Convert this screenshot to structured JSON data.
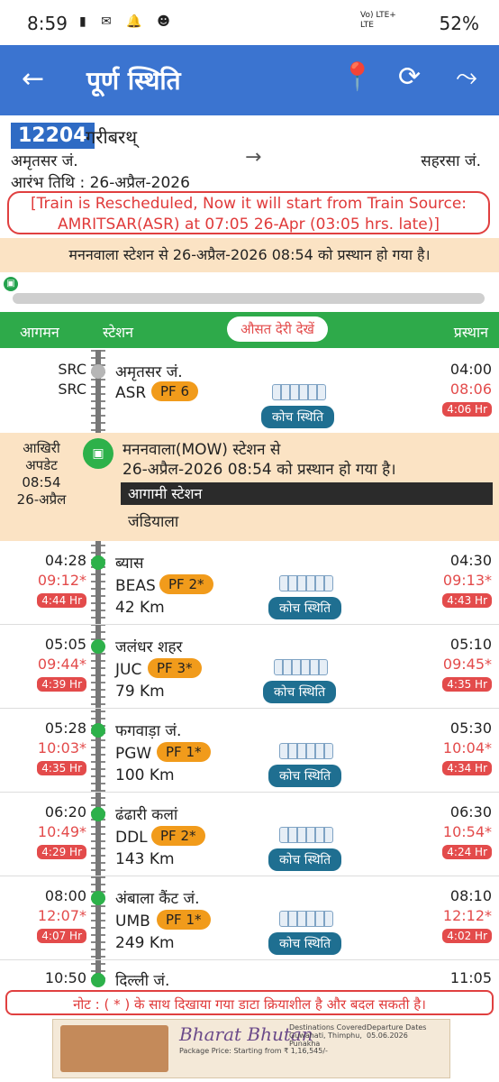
{
  "status": {
    "time": "8:59",
    "network": "Vo) LTE+\nLTE",
    "battery": "52%"
  },
  "appbar": {
    "title": "पूर्ण स्थिति",
    "back_icon": "←",
    "location_icon": "📍",
    "refresh_icon": "⟳",
    "route_icon": "⤳"
  },
  "train": {
    "number": "12204",
    "name": "गरीबरथ्",
    "source": "अमृतसर जं.",
    "destination": "सहरसा जं.",
    "start_date": "आरंभ तिथि : 26-अप्रैल-2026",
    "arrow": "→"
  },
  "reschedule": "[Train is Rescheduled, Now it will start from Train Source: AMRITSAR(ASR) at 07:05 26-Apr (03:05 hrs. late)]",
  "info": "मननवाला स्टेशन से 26-अप्रैल-2026 08:54 को प्रस्थान हो गया है।",
  "header": {
    "arrival": "आगमन",
    "station": "स्टेशन",
    "avg_delay": "औसत देरी देखें",
    "departure": "प्रस्थान"
  },
  "coach_label": "कोच स्थिति",
  "stations": [
    {
      "arr_time": "SRC",
      "arr_actual": "SRC",
      "arr_late": "",
      "name": "अमृतसर जं.",
      "code": "ASR",
      "pf": "PF 6",
      "km": "",
      "dep_time": "04:00",
      "dep_actual": "08:06",
      "dep_late": "4:06 Hr"
    },
    {
      "arr_time": "04:28",
      "arr_actual": "09:12*",
      "arr_late": "4:44 Hr",
      "name": "ब्यास",
      "code": "BEAS",
      "pf": "PF 2*",
      "km": "42 Km",
      "dep_time": "04:30",
      "dep_actual": "09:13*",
      "dep_late": "4:43 Hr"
    },
    {
      "arr_time": "05:05",
      "arr_actual": "09:44*",
      "arr_late": "4:39 Hr",
      "name": "जलंधर शहर",
      "code": "JUC",
      "pf": "PF 3*",
      "km": "79 Km",
      "dep_time": "05:10",
      "dep_actual": "09:45*",
      "dep_late": "4:35 Hr"
    },
    {
      "arr_time": "05:28",
      "arr_actual": "10:03*",
      "arr_late": "4:35 Hr",
      "name": "फगवाड़ा जं.",
      "code": "PGW",
      "pf": "PF 1*",
      "km": "100 Km",
      "dep_time": "05:30",
      "dep_actual": "10:04*",
      "dep_late": "4:34 Hr"
    },
    {
      "arr_time": "06:20",
      "arr_actual": "10:49*",
      "arr_late": "4:29 Hr",
      "name": "ढंढारी कलां",
      "code": "DDL",
      "pf": "PF 2*",
      "km": "143 Km",
      "dep_time": "06:30",
      "dep_actual": "10:54*",
      "dep_late": "4:24 Hr"
    },
    {
      "arr_time": "08:00",
      "arr_actual": "12:07*",
      "arr_late": "4:07 Hr",
      "name": "अंबाला कैंट जं.",
      "code": "UMB",
      "pf": "PF 1*",
      "km": "249 Km",
      "dep_time": "08:10",
      "dep_actual": "12:12*",
      "dep_late": "4:02 Hr"
    },
    {
      "arr_time": "10:50",
      "arr_actual": "",
      "arr_late": "",
      "name": "दिल्ली जं.",
      "code": "",
      "pf": "",
      "km": "",
      "dep_time": "11:05",
      "dep_actual": "",
      "dep_late": ""
    }
  ],
  "last_update": {
    "label": "आखिरी\nअपडेट\n08:54\n26-अप्रैल",
    "message": "मननवाला(MOW) स्टेशन से\n26-अप्रैल-2026 08:54 को प्रस्थान हो गया है।",
    "next_label": "आगामी स्टेशन",
    "next_station": "जंडियाला"
  },
  "note": "नोट : ( * ) के साथ दिखाया गया डाटा क्रियाशील है और बदल सकती है।",
  "ad": {
    "brand": "Bharat Bhutan",
    "line1": "Destinations Covered: Guwahati, Thimphu, Punakha",
    "line2": "Departure Dates 05.06.2026",
    "line3": "Package Price: Starting from ₹ 1,16,545/-"
  }
}
